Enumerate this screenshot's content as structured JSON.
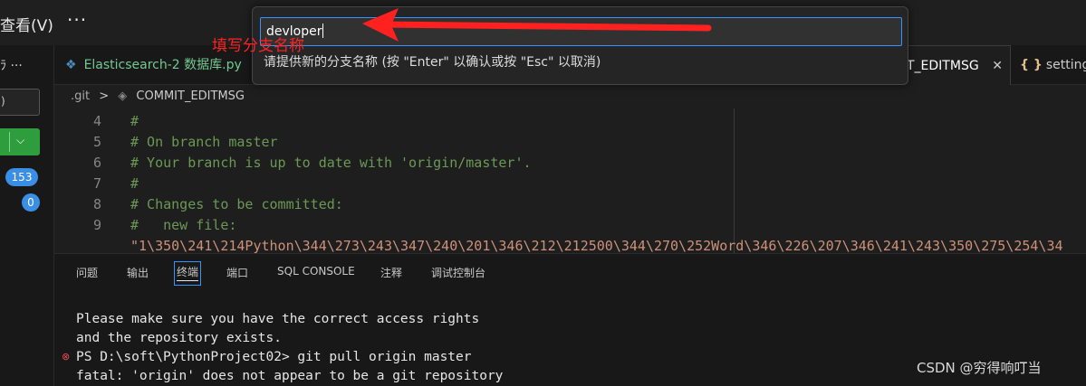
{
  "menu": {
    "view": "查看(V)",
    "more": "···"
  },
  "sidebar": {
    "top_label": "ﾗ ···",
    "input_value": ")",
    "badge_changes": "153",
    "badge_staged": "0"
  },
  "tabs": [
    {
      "label": "Elasticsearch-2 数据库.py",
      "modified": false
    },
    {
      "label": "T_EDITMSG",
      "close": "✕"
    },
    {
      "label": "setting",
      "icon": "{ }"
    }
  ],
  "breadcrumb": {
    "folder": ".git",
    "sep": ">",
    "file": "COMMIT_EDITMSG"
  },
  "editor": {
    "lines": [
      {
        "num": "4",
        "text": "#"
      },
      {
        "num": "5",
        "text": "# On branch master"
      },
      {
        "num": "6",
        "text": "# Your branch is up to date with 'origin/master'."
      },
      {
        "num": "7",
        "text": "#"
      },
      {
        "num": "8",
        "text": "# Changes to be committed:"
      },
      {
        "num": "9",
        "text": "#   new file:"
      }
    ],
    "wrapped": "\"1\\350\\241\\214Python\\344\\273\\243\\347\\240\\201\\346\\212\\212500\\344\\270\\252Word\\346\\226\\207\\346\\241\\243\\350\\275\\254\\34"
  },
  "panel": {
    "tabs": [
      "问题",
      "输出",
      "终端",
      "端口",
      "SQL CONSOLE",
      "注释",
      "调试控制台"
    ],
    "active_tab": "终端",
    "terminal": [
      "Please make sure you have the correct access rights",
      "and the repository exists.",
      "PS D:\\soft\\PythonProject02> git pull origin master",
      "fatal: 'origin' does not appear to be a git repository"
    ],
    "error_marker": "⊗"
  },
  "quick_input": {
    "value": "devloper",
    "hint": "请提供新的分支名称 (按 \"Enter\" 以确认或按 \"Esc\" 以取消)"
  },
  "annotation": {
    "text": "填写分支名称",
    "color": "#ff2222"
  },
  "watermark": "CSDN @穷得响叮当",
  "colors": {
    "accent": "#3794ff",
    "commit_button": "#2e9d3d",
    "badge": "#3a8ee6",
    "comment": "#6a9955"
  }
}
